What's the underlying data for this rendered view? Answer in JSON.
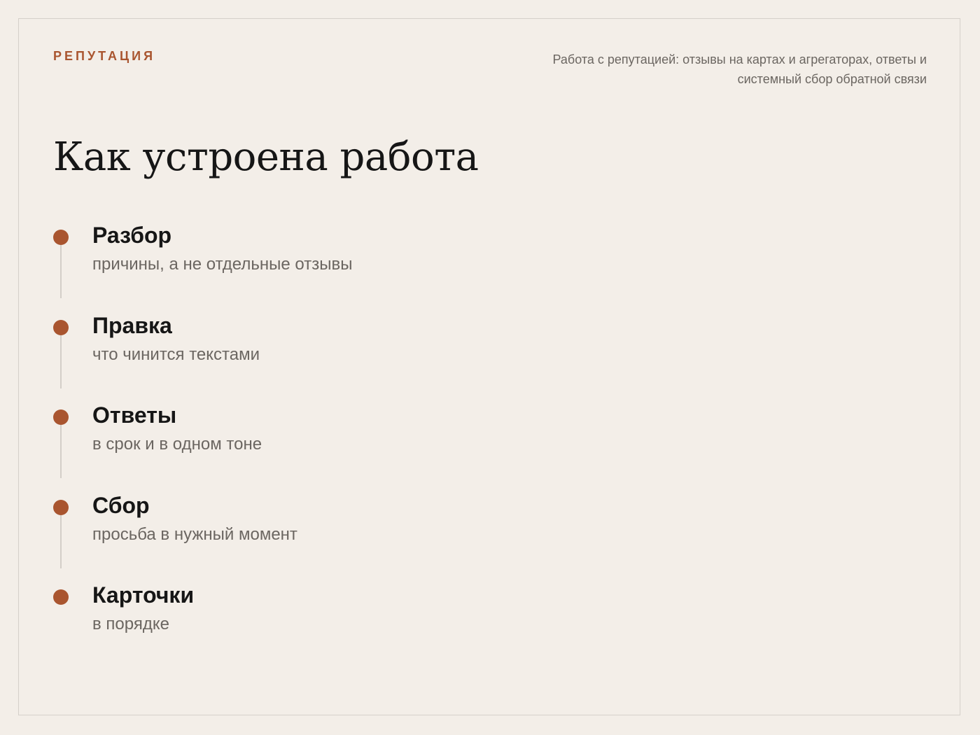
{
  "header": {
    "eyebrow": "РЕПУТАЦИЯ",
    "lede": "Работа с репутацией: отзывы на картах и агрегаторах, ответы и системный сбор обратной связи"
  },
  "main": {
    "title": "Как устроена работа",
    "steps": [
      {
        "title": "Разбор",
        "description": "причины, а не отдельные отзывы"
      },
      {
        "title": "Правка",
        "description": "что чинится текстами"
      },
      {
        "title": "Ответы",
        "description": "в срок и в одном тоне"
      },
      {
        "title": "Сбор",
        "description": "просьба в нужный момент"
      },
      {
        "title": "Карточки",
        "description": "в порядке"
      }
    ]
  },
  "colors": {
    "accent": "#a9552f",
    "background": "#f3eee8",
    "muted_text": "#6b6661",
    "connector": "#d3cec8"
  }
}
